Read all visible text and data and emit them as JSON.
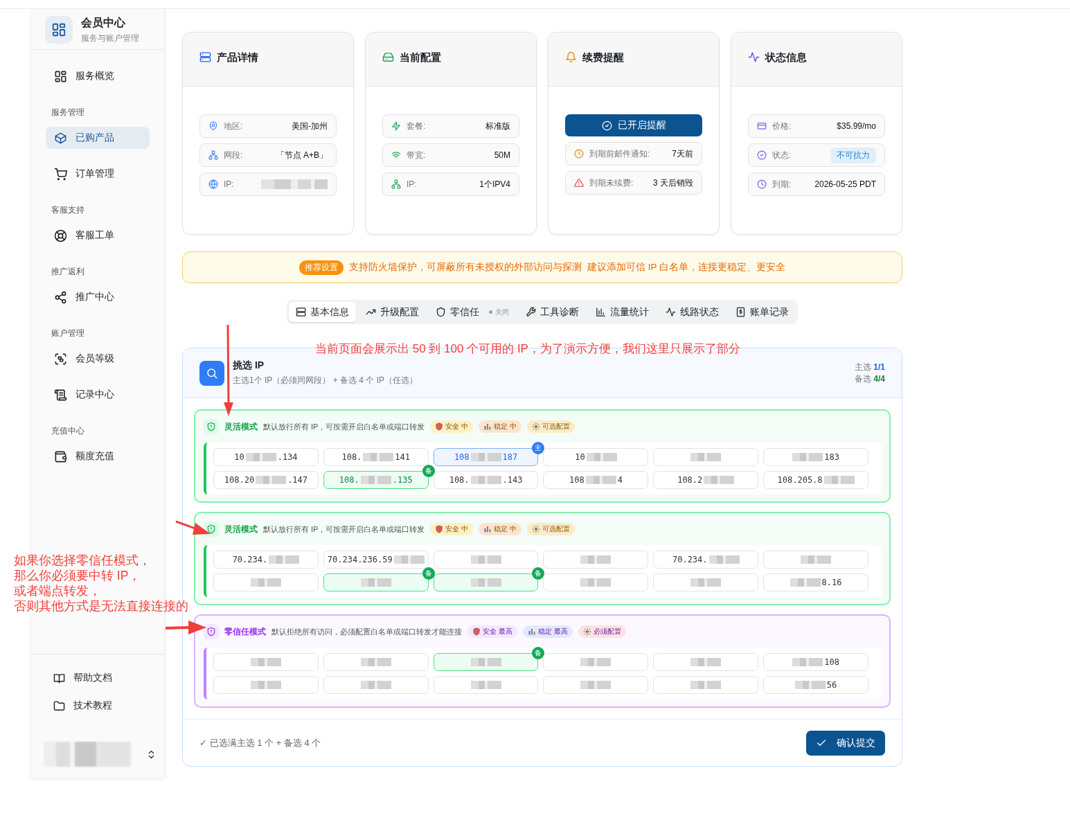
{
  "sidebar": {
    "brand": {
      "title": "会员中心",
      "subtitle": "服务与账户管理"
    },
    "sections": [
      {
        "items": [
          {
            "label": "服务概览",
            "selected": false
          }
        ]
      },
      {
        "heading": "服务管理",
        "items": [
          {
            "label": "已购产品",
            "selected": true
          },
          {
            "label": "订单管理",
            "selected": false
          }
        ]
      },
      {
        "heading": "客服支持",
        "items": [
          {
            "label": "客服工单",
            "selected": false
          }
        ]
      },
      {
        "heading": "推广返利",
        "items": [
          {
            "label": "推广中心",
            "selected": false
          }
        ]
      },
      {
        "heading": "账户管理",
        "items": [
          {
            "label": "会员等级",
            "selected": false
          },
          {
            "label": "记录中心",
            "selected": false
          }
        ]
      },
      {
        "heading": "充值中心",
        "items": [
          {
            "label": "额度充值",
            "selected": false
          }
        ]
      }
    ],
    "bottom_items": [
      {
        "label": "帮助文档"
      },
      {
        "label": "技术教程"
      }
    ]
  },
  "cards": [
    {
      "title": "产品详情",
      "kind": "list",
      "items": [
        {
          "label": "地区:",
          "value": "美国-加州"
        },
        {
          "label": "网段:",
          "value": "「节点 A+B」"
        },
        {
          "label": "IP:",
          "redacted": true
        }
      ]
    },
    {
      "title": "当前配置",
      "kind": "list",
      "items": [
        {
          "label": "套餐:",
          "value": "标准版"
        },
        {
          "label": "带宽:",
          "value": "50M"
        },
        {
          "label": "IP:",
          "value": "1个IPV4"
        }
      ]
    },
    {
      "title": "续费提醒",
      "kind": "reminder",
      "button": {
        "label": "已开启提醒",
        "on": true
      },
      "items": [
        {
          "label": "到期前邮件通知:",
          "value": "7天前"
        },
        {
          "label": "到期未续费:",
          "value": "3 天后销毁"
        }
      ]
    },
    {
      "title": "状态信息",
      "kind": "list",
      "items": [
        {
          "label": "价格:",
          "value": "$35.99/mo"
        },
        {
          "label": "状态:",
          "value": "不可抗力",
          "kind": "badge"
        },
        {
          "label": "到期:",
          "value": "2026-05-25 PDT"
        }
      ]
    }
  ],
  "banner": {
    "badge": "推荐设置",
    "text": "支持防火墙保护，可屏蔽所有未授权的外部访问与探测",
    "suggestion": "建议添加可信 IP 白名单，连接更稳定、更安全"
  },
  "tabs": [
    {
      "label": "基本信息",
      "selected": true
    },
    {
      "label": "升级配置",
      "selected": false
    },
    {
      "label": "零信任",
      "selected": false,
      "status": "关闭"
    },
    {
      "label": "工具诊断",
      "selected": false
    },
    {
      "label": "流量统计",
      "selected": false
    },
    {
      "label": "线路状态",
      "selected": false
    },
    {
      "label": "账单记录",
      "selected": false
    }
  ],
  "picker": {
    "title": "挑选 IP",
    "subtitle": "主选1个 IP（必须同网段） + 备选 4 个 IP（任选）",
    "primary": {
      "label": "主选",
      "value": "1/1"
    },
    "backup": {
      "label": "备选",
      "value": "4/4"
    },
    "groups": [
      {
        "kind": "flexible",
        "mode": "灵活模式",
        "description": "默认放行所有 IP，可按需开启白名单或端口转发",
        "tags": [
          {
            "label": "安全 中",
            "color": "#fdf1c3"
          },
          {
            "label": "稳定 中",
            "color": "#fde4cf"
          },
          {
            "label": "可选配置",
            "color": "#fdebc8"
          }
        ],
        "chips": [
          {
            "prefix": "10",
            "suffix": ".134",
            "selected": false
          },
          {
            "prefix": "108.",
            "suffix": "141",
            "selected": false
          },
          {
            "prefix": "108",
            "suffix": "187",
            "kind": "primary",
            "badge": "主",
            "selected": true
          },
          {
            "prefix": "10",
            "selected": false
          },
          {
            "selected": false
          },
          {
            "suffix": "183",
            "selected": false
          },
          {
            "prefix": "108.20",
            "suffix": ".147",
            "selected": false
          },
          {
            "prefix": "108.",
            "suffix": ".135",
            "kind": "backup",
            "badge": "备",
            "selected": true
          },
          {
            "prefix": "108.",
            "suffix": ".143",
            "selected": false
          },
          {
            "prefix": "108",
            "suffix": "4",
            "selected": false
          },
          {
            "prefix": "108.2",
            "selected": false
          },
          {
            "prefix": "108.205.8",
            "selected": false
          }
        ]
      },
      {
        "kind": "flexible",
        "mode": "灵活模式",
        "description": "默认放行所有 IP，可按需开启白名单或端口转发",
        "tags": [
          {
            "label": "安全 中",
            "color": "#fdf1c3"
          },
          {
            "label": "稳定 中",
            "color": "#fde4cf"
          },
          {
            "label": "可选配置",
            "color": "#fdebc8"
          }
        ],
        "chips": [
          {
            "prefix": "70.234.",
            "selected": false
          },
          {
            "prefix": "70.234.236.59",
            "selected": false
          },
          {
            "selected": false
          },
          {
            "selected": false
          },
          {
            "prefix": "70.234.",
            "selected": false
          },
          {
            "selected": false
          },
          {
            "selected": false
          },
          {
            "kind": "backup",
            "badge": "备",
            "selected": true
          },
          {
            "kind": "backup",
            "badge": "备",
            "selected": true
          },
          {
            "selected": false
          },
          {
            "selected": false
          },
          {
            "suffix": "8.16",
            "selected": false
          }
        ]
      },
      {
        "kind": "zero_trust",
        "mode": "零信任模式",
        "description": "默认拒绝所有访问，必须配置白名单或端口转发才能连接",
        "tags": [
          {
            "label": "安全 最高",
            "color": "#f3e8ff"
          },
          {
            "label": "稳定 最高",
            "color": "#e0e9ff"
          },
          {
            "label": "必须配置",
            "color": "#fde2e2"
          }
        ],
        "chips": [
          {
            "selected": false
          },
          {
            "selected": false
          },
          {
            "kind": "backup",
            "badge": "备",
            "selected": true
          },
          {
            "selected": false
          },
          {
            "selected": false
          },
          {
            "suffix": "108",
            "selected": false
          },
          {
            "selected": false
          },
          {
            "selected": false
          },
          {
            "selected": false
          },
          {
            "selected": false
          },
          {
            "selected": false
          },
          {
            "suffix": "56",
            "selected": false
          }
        ]
      }
    ]
  },
  "footer": {
    "status": "✓ 已选满主选 1 个 + 备选 4 个",
    "submit": "确认提交"
  },
  "annotations": [
    {
      "kind": "top",
      "text": "当前页面会展示出 50 到 100 个可用的 IP，为了演示方便，我们这里只展示了部分"
    },
    {
      "kind": "side",
      "lines": [
        "如果你选择零信任模式，",
        "那么你必须要中转 IP，",
        "或者端点转发，",
        "否则其他方式是无法直接连接的"
      ]
    }
  ]
}
